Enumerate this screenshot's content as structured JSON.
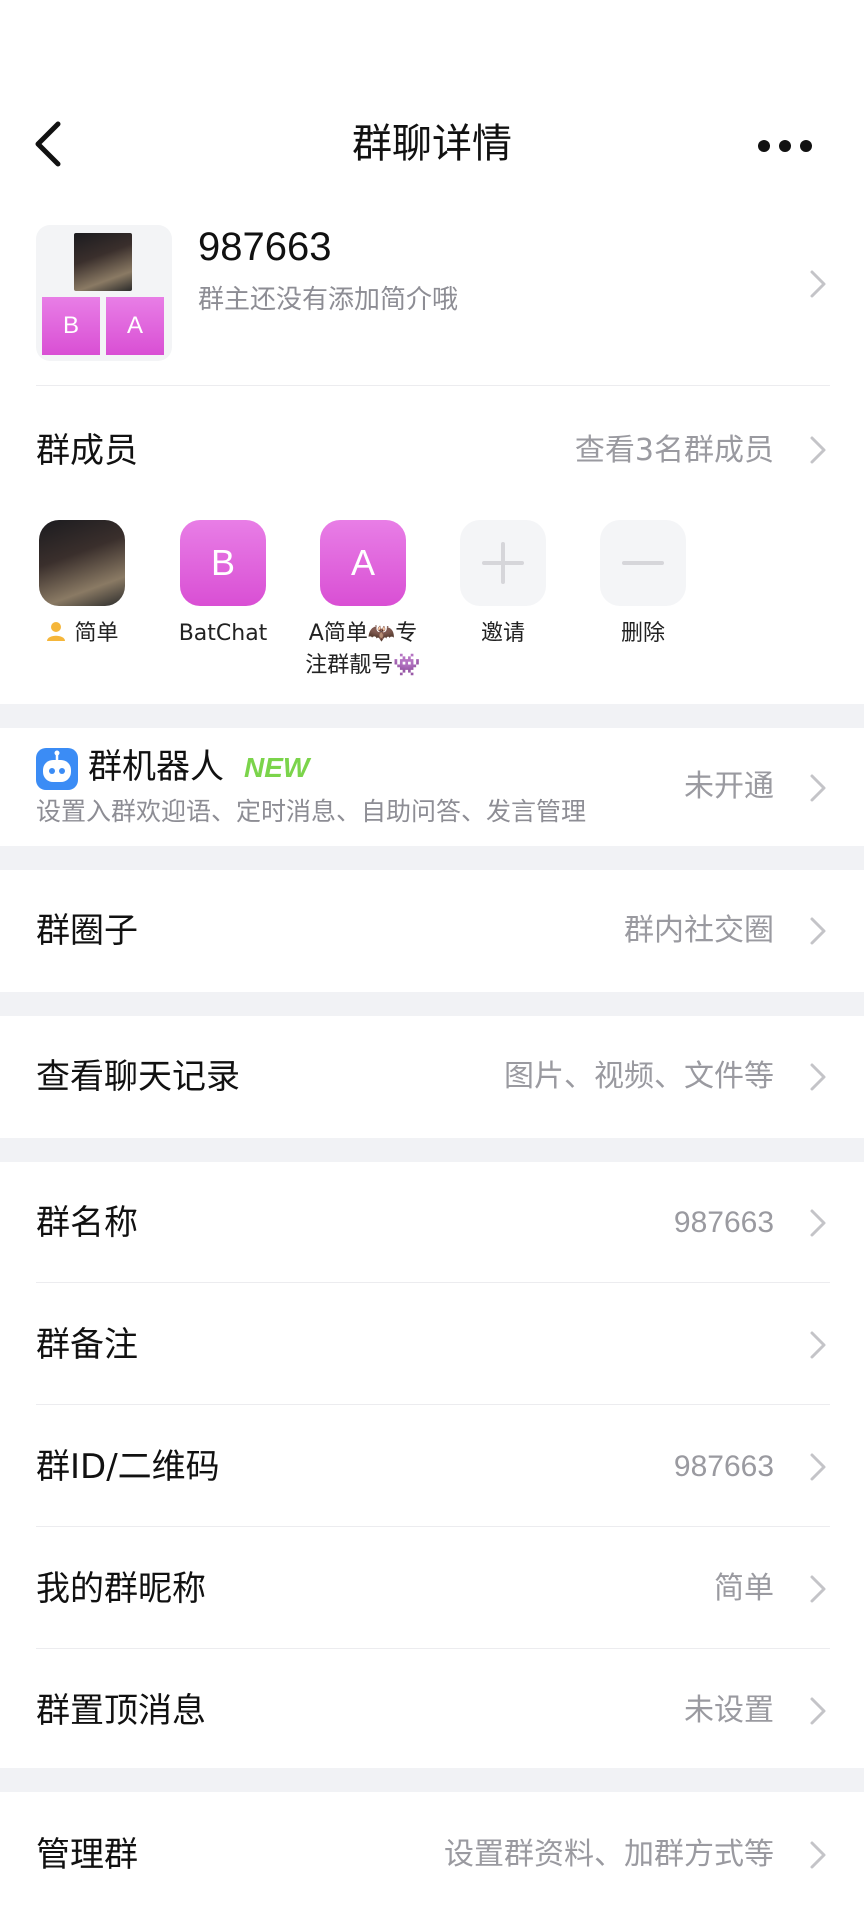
{
  "header": {
    "title": "群聊详情"
  },
  "group": {
    "collage_letters": [
      "B",
      "A"
    ],
    "name": "987663",
    "intro": "群主还没有添加简介哦"
  },
  "members": {
    "label": "群成员",
    "view_all": "查看3名群成员",
    "items": [
      {
        "label": "简单",
        "avatar_type": "photo",
        "prefix_icon": "person-emoji-icon"
      },
      {
        "label": "BatChat",
        "avatar_type": "letter",
        "letter": "B"
      },
      {
        "label": "A简单🦇专注群靓号👾",
        "avatar_type": "letter",
        "letter": "A"
      },
      {
        "label": "邀请",
        "avatar_type": "action",
        "icon": "plus-icon"
      },
      {
        "label": "删除",
        "avatar_type": "action",
        "icon": "minus-icon"
      }
    ]
  },
  "bot": {
    "title": "群机器人",
    "badge": "NEW",
    "desc": "设置入群欢迎语、定时消息、自助问答、发言管理",
    "value": "未开通"
  },
  "circle": {
    "label": "群圈子",
    "value": "群内社交圈"
  },
  "history": {
    "label": "查看聊天记录",
    "value": "图片、视频、文件等"
  },
  "settings": {
    "name": {
      "label": "群名称",
      "value": "987663"
    },
    "remark": {
      "label": "群备注",
      "value": ""
    },
    "id_qr": {
      "label": "群ID/二维码",
      "value": "987663"
    },
    "nickname": {
      "label": "我的群昵称",
      "value": "简单"
    },
    "pinned": {
      "label": "群置顶消息",
      "value": "未设置"
    }
  },
  "manage": {
    "label": "管理群",
    "value": "设置群资料、加群方式等"
  },
  "colors": {
    "accent_pink": "#d94fd4",
    "new_badge": "#7bd44b",
    "bot_blue": "#3b8cf5",
    "divider_band": "#f1f2f5"
  }
}
